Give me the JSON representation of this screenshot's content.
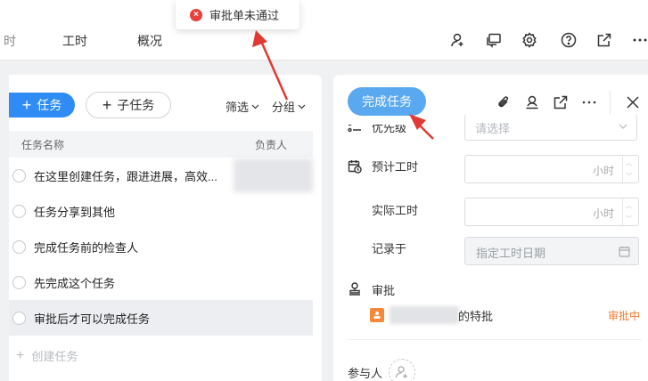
{
  "toast": {
    "message": "审批单未通过",
    "color": "#e8403b"
  },
  "top_tabs": [
    {
      "label": "时"
    },
    {
      "label": "工时"
    },
    {
      "label": "概况"
    }
  ],
  "toolbar_icons": [
    "people-icon",
    "chat-icon",
    "gear-icon",
    "help-icon",
    "share-icon",
    "more-icon"
  ],
  "left": {
    "add_task": "任务",
    "add_subtask": "子任务",
    "filter": "筛选",
    "group": "分组",
    "columns": {
      "name": "任务名称",
      "owner": "负责人"
    },
    "tasks": [
      {
        "title": "在这里创建任务，跟进进展，高效..."
      },
      {
        "title": "任务分享到其他"
      },
      {
        "title": "完成任务前的检查人"
      },
      {
        "title": "先完成这个任务"
      },
      {
        "title": "审批后才可以完成任务"
      }
    ],
    "create_task": "创建任务"
  },
  "right": {
    "complete_button": "完成任务",
    "priority": {
      "label": "优先级",
      "placeholder": "请选择"
    },
    "estimated": {
      "label": "预计工时",
      "unit": "小时"
    },
    "actual": {
      "label": "实际工时",
      "unit": "小时"
    },
    "recorded": {
      "label": "记录于",
      "placeholder": "指定工时日期"
    },
    "approval": {
      "label": "审批",
      "item": "的特批",
      "status": "审批中",
      "status_color": "#f07a2b"
    },
    "participants": {
      "label": "参与人"
    }
  },
  "accent": "#2f8cf4"
}
